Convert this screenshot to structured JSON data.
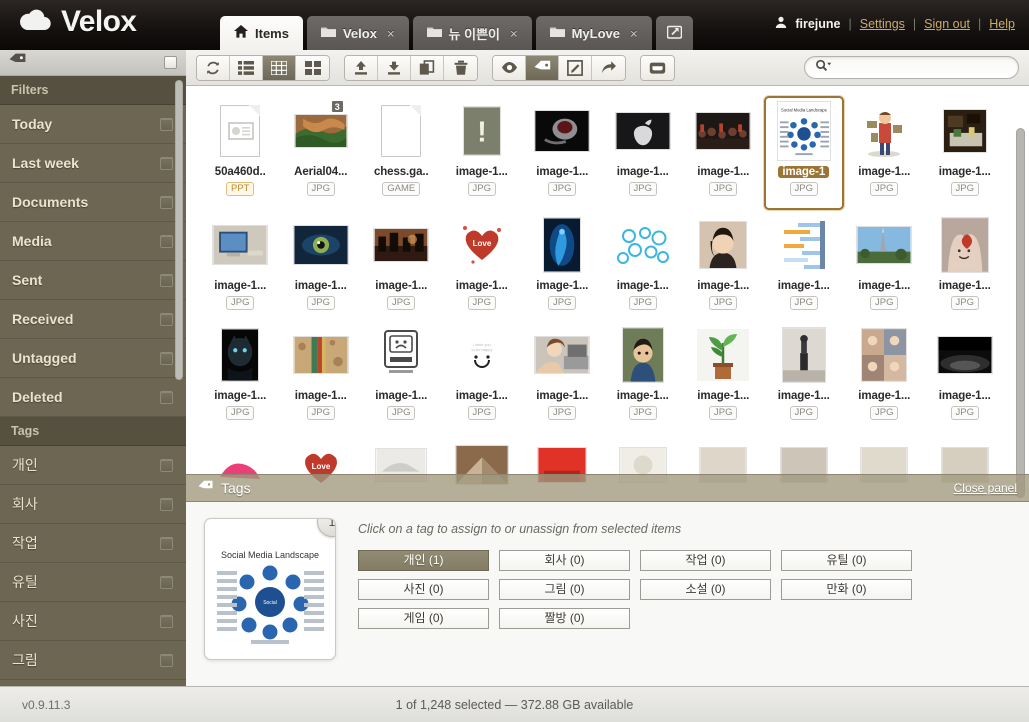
{
  "brand": {
    "name": "Velox",
    "logo_icon": "cloud-icon"
  },
  "tabs": [
    {
      "label": "Items",
      "icon": "home-icon",
      "active": true,
      "closable": false
    },
    {
      "label": "Velox",
      "icon": "folder-icon",
      "active": false,
      "closable": true
    },
    {
      "label": "뉴 이쁜이",
      "icon": "folder-icon",
      "active": false,
      "closable": true
    },
    {
      "label": "MyLove",
      "icon": "folder-icon",
      "active": false,
      "closable": true
    }
  ],
  "new_tab_icon": "share-box-icon",
  "tab_close_glyph": "×",
  "user": {
    "name": "firejune",
    "avatar_icon": "user-icon",
    "links": [
      "Settings",
      "Sign out",
      "Help"
    ],
    "separator": "|"
  },
  "sidebar": {
    "header_icon": "tag-icon",
    "sections": [
      {
        "title": "Filters",
        "items": [
          {
            "label": "Today"
          },
          {
            "label": "Last week"
          },
          {
            "label": "Documents"
          },
          {
            "label": "Media"
          },
          {
            "label": "Sent"
          },
          {
            "label": "Received"
          },
          {
            "label": "Untagged"
          },
          {
            "label": "Deleted"
          }
        ]
      },
      {
        "title": "Tags",
        "korean": true,
        "items": [
          {
            "label": "개인"
          },
          {
            "label": "회사"
          },
          {
            "label": "작업"
          },
          {
            "label": "유틸"
          },
          {
            "label": "사진"
          },
          {
            "label": "그림"
          }
        ]
      }
    ]
  },
  "toolbar": {
    "groups": [
      [
        {
          "icon": "refresh-icon",
          "active": false
        },
        {
          "icon": "list-view-icon",
          "active": false
        },
        {
          "icon": "grid-view-icon",
          "active": true
        },
        {
          "icon": "tile-view-icon",
          "active": false
        }
      ],
      [
        {
          "icon": "upload-icon",
          "active": false
        },
        {
          "icon": "download-icon",
          "active": false
        },
        {
          "icon": "copy-icon",
          "active": false
        },
        {
          "icon": "trash-icon",
          "active": false
        }
      ],
      [
        {
          "icon": "eye-icon",
          "active": false
        },
        {
          "icon": "tag-icon",
          "active": true
        },
        {
          "icon": "edit-icon",
          "active": false
        },
        {
          "icon": "forward-icon",
          "active": false
        }
      ],
      [
        {
          "icon": "inbox-icon",
          "active": false
        }
      ]
    ]
  },
  "search": {
    "value": "",
    "placeholder": "",
    "icon": "search-dropdown-icon"
  },
  "files": [
    {
      "name": "50a460d..",
      "type": "PPT",
      "thumb": "doc-presentation",
      "stack": null,
      "selected": false
    },
    {
      "name": "Aerial04...",
      "type": "JPG",
      "thumb": "photo-canyon",
      "stack": "3",
      "selected": false
    },
    {
      "name": "chess.ga..",
      "type": "GAME",
      "thumb": "doc-blank",
      "stack": null,
      "selected": false
    },
    {
      "name": "image-1...",
      "type": "JPG",
      "thumb": "photo-question",
      "stack": null,
      "selected": false
    },
    {
      "name": "image-1...",
      "type": "JPG",
      "thumb": "photo-ring",
      "stack": null,
      "selected": false
    },
    {
      "name": "image-1...",
      "type": "JPG",
      "thumb": "photo-apple",
      "stack": null,
      "selected": false
    },
    {
      "name": "image-1...",
      "type": "JPG",
      "thumb": "photo-crowd",
      "stack": null,
      "selected": false
    },
    {
      "name": "image-1",
      "type": "JPG",
      "thumb": "photo-socialmedia",
      "stack": null,
      "selected": true
    },
    {
      "name": "image-1...",
      "type": "JPG",
      "thumb": "photo-cartoon",
      "stack": null,
      "selected": false
    },
    {
      "name": "image-1...",
      "type": "JPG",
      "thumb": "photo-desk",
      "stack": null,
      "selected": false
    },
    {
      "name": "image-1...",
      "type": "JPG",
      "thumb": "photo-monitor",
      "stack": null,
      "selected": false
    },
    {
      "name": "image-1...",
      "type": "JPG",
      "thumb": "photo-eye",
      "stack": null,
      "selected": false
    },
    {
      "name": "image-1...",
      "type": "JPG",
      "thumb": "photo-city",
      "stack": null,
      "selected": false
    },
    {
      "name": "image-1...",
      "type": "JPG",
      "thumb": "photo-iloveyou",
      "stack": null,
      "selected": false
    },
    {
      "name": "image-1...",
      "type": "JPG",
      "thumb": "photo-bluefigure",
      "stack": null,
      "selected": false
    },
    {
      "name": "image-1...",
      "type": "JPG",
      "thumb": "photo-bluepattern",
      "stack": null,
      "selected": false
    },
    {
      "name": "image-1...",
      "type": "JPG",
      "thumb": "photo-portrait",
      "stack": null,
      "selected": false
    },
    {
      "name": "image-1...",
      "type": "JPG",
      "thumb": "photo-chart",
      "stack": null,
      "selected": false
    },
    {
      "name": "image-1...",
      "type": "JPG",
      "thumb": "photo-tower",
      "stack": null,
      "selected": false
    },
    {
      "name": "image-1...",
      "type": "JPG",
      "thumb": "photo-hand",
      "stack": null,
      "selected": false
    },
    {
      "name": "image-1...",
      "type": "JPG",
      "thumb": "photo-panther",
      "stack": null,
      "selected": false
    },
    {
      "name": "image-1...",
      "type": "JPG",
      "thumb": "photo-wall",
      "stack": null,
      "selected": false
    },
    {
      "name": "image-1...",
      "type": "JPG",
      "thumb": "photo-mac",
      "stack": null,
      "selected": false
    },
    {
      "name": "image-1...",
      "type": "JPG",
      "thumb": "photo-smiley",
      "stack": null,
      "selected": false
    },
    {
      "name": "image-1...",
      "type": "JPG",
      "thumb": "photo-laptopgirl",
      "stack": null,
      "selected": false
    },
    {
      "name": "image-1...",
      "type": "JPG",
      "thumb": "photo-boy",
      "stack": null,
      "selected": false
    },
    {
      "name": "image-1...",
      "type": "JPG",
      "thumb": "photo-plant",
      "stack": null,
      "selected": false
    },
    {
      "name": "image-1...",
      "type": "JPG",
      "thumb": "photo-standing",
      "stack": null,
      "selected": false
    },
    {
      "name": "image-1...",
      "type": "JPG",
      "thumb": "photo-collage",
      "stack": null,
      "selected": false
    },
    {
      "name": "image-1...",
      "type": "JPG",
      "thumb": "photo-bw",
      "stack": null,
      "selected": false
    },
    {
      "name": "",
      "type": "",
      "thumb": "photo-pink",
      "stack": null,
      "selected": false
    },
    {
      "name": "",
      "type": "",
      "thumb": "photo-love2",
      "stack": null,
      "selected": false
    },
    {
      "name": "",
      "type": "",
      "thumb": "photo-white",
      "stack": null,
      "selected": false
    },
    {
      "name": "",
      "type": "",
      "thumb": "photo-paper",
      "stack": null,
      "selected": false
    },
    {
      "name": "",
      "type": "",
      "thumb": "photo-red",
      "stack": null,
      "selected": false
    },
    {
      "name": "",
      "type": "",
      "thumb": "photo-light",
      "stack": null,
      "selected": false
    },
    {
      "name": "",
      "type": "",
      "thumb": "photo-misc1",
      "stack": null,
      "selected": false
    },
    {
      "name": "",
      "type": "",
      "thumb": "photo-misc2",
      "stack": null,
      "selected": false
    },
    {
      "name": "",
      "type": "",
      "thumb": "photo-misc3",
      "stack": null,
      "selected": false
    },
    {
      "name": "",
      "type": "",
      "thumb": "photo-misc4",
      "stack": null,
      "selected": false
    }
  ],
  "panel": {
    "title": "Tags",
    "title_icon": "tag-icon",
    "close_label": "Close panel",
    "hint": "Click on a tag to assign to or unassign from selected items",
    "preview": {
      "caption": "Social Media Landscape",
      "count_badge": "1"
    },
    "tags": [
      {
        "label": "개인 (1)",
        "active": true
      },
      {
        "label": "회사 (0)",
        "active": false
      },
      {
        "label": "작업 (0)",
        "active": false
      },
      {
        "label": "유틸 (0)",
        "active": false
      },
      {
        "label": "사진 (0)",
        "active": false
      },
      {
        "label": "그림 (0)",
        "active": false
      },
      {
        "label": "소설 (0)",
        "active": false
      },
      {
        "label": "만화 (0)",
        "active": false
      },
      {
        "label": "게임 (0)",
        "active": false
      },
      {
        "label": "짤방 (0)",
        "active": false
      }
    ]
  },
  "status": {
    "version": "v0.9.11.3",
    "text": "1 of 1,248 selected — 372.88 GB available"
  },
  "colors": {
    "accent_brown": "#9c7433",
    "sidebar_bg": "#6d6653",
    "topbar_bg": "#14110f",
    "link_gold": "#cbab6b"
  }
}
